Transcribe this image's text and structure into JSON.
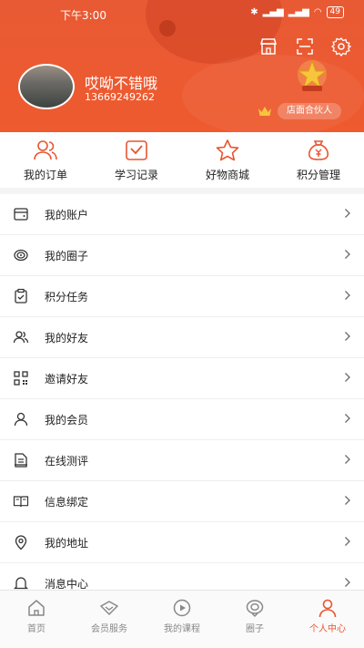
{
  "status_bar": {
    "time": "下午3:00",
    "battery": "49"
  },
  "profile": {
    "name": "哎呦不错哦",
    "phone": "13669249262",
    "partner_label": "店面合伙人"
  },
  "quick_actions": [
    {
      "label": "我的订单",
      "icon": "user-group-icon"
    },
    {
      "label": "学习记录",
      "icon": "check-doc-icon"
    },
    {
      "label": "好物商城",
      "icon": "star-icon"
    },
    {
      "label": "积分管理",
      "icon": "money-bag-icon"
    }
  ],
  "menu": [
    {
      "label": "我的账户",
      "icon": "wallet-icon"
    },
    {
      "label": "我的圈子",
      "icon": "circle-icon"
    },
    {
      "label": "积分任务",
      "icon": "clipboard-check-icon"
    },
    {
      "label": "我的好友",
      "icon": "friends-icon"
    },
    {
      "label": "邀请好友",
      "icon": "qrcode-icon"
    },
    {
      "label": "我的会员",
      "icon": "person-icon"
    },
    {
      "label": "在线测评",
      "icon": "document-icon"
    },
    {
      "label": "信息绑定",
      "icon": "book-icon"
    },
    {
      "label": "我的地址",
      "icon": "location-icon"
    },
    {
      "label": "消息中心",
      "icon": "bell-icon"
    }
  ],
  "tabs": [
    {
      "label": "首页",
      "icon": "home-icon"
    },
    {
      "label": "会员服务",
      "icon": "vip-icon"
    },
    {
      "label": "我的课程",
      "icon": "play-icon"
    },
    {
      "label": "圈子",
      "icon": "circle-tab-icon"
    },
    {
      "label": "个人中心",
      "icon": "person-tab-icon",
      "active": true
    }
  ],
  "colors": {
    "accent": "#e8552f",
    "header": "#ef5a2f"
  }
}
